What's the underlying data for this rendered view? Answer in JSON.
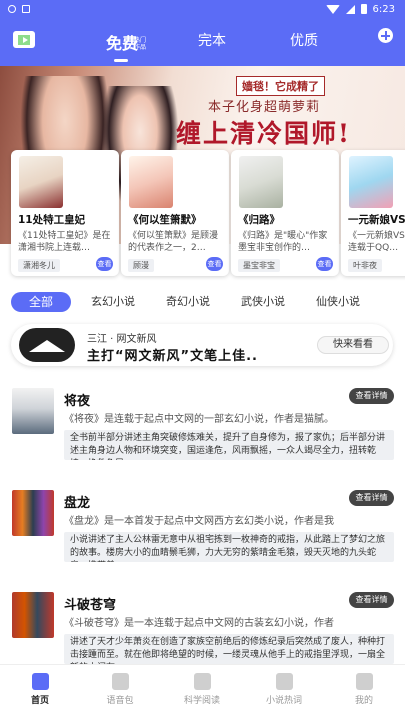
{
  "status": {
    "time": "6:23"
  },
  "nav": {
    "tabs": [
      {
        "label": "免费",
        "sub": "热门作品"
      },
      {
        "label": "完本"
      },
      {
        "label": "优质"
      }
    ]
  },
  "banner": {
    "tag": "嫱毯！它成精了",
    "subtitle": "本子化身超萌萝莉",
    "title": "缠上清冷国师!"
  },
  "featured": [
    {
      "title": "11处特工皇妃",
      "desc": "《11处特工皇妃》是在潇湘书院上连载…",
      "author": "潇湘冬儿",
      "view": "查看"
    },
    {
      "title": "《何以笙箫默》",
      "desc": "《何以笙箫默》是顾漫的代表作之一，2…",
      "author": "顾漫",
      "view": "查看"
    },
    {
      "title": "《归路》",
      "desc": "《归路》是\"暖心\"作家墨宝非宝创作的…",
      "author": "墨宝非宝",
      "view": "查看"
    },
    {
      "title": "一元新娘VS全",
      "desc": "《一元新娘VS全席》是连载于QQ…",
      "author": "叶非夜",
      "view": "查看"
    }
  ],
  "categories": [
    "全部",
    "玄幻小说",
    "奇幻小说",
    "武侠小说",
    "仙侠小说"
  ],
  "promo": {
    "top": "三江 · 网文新风",
    "main": "主打“网文新风”文笔上佳..",
    "button": "快来看看"
  },
  "books": [
    {
      "title": "将夜",
      "desc": "《将夜》是连载于起点中文网的一部玄幻小说，作者是猫腻。",
      "button": "查看详情",
      "summary": "全书前半部分讲述主角突破修炼难关，提升了自身修为，报了家仇；后半部分讲述主角身边人物和环境突变，国运逢危，风雨飘摇，一众人竭尽全力，扭转乾坤，挽救危局…"
    },
    {
      "title": "盘龙",
      "desc": "《盘龙》是一本首发于起点中文网西方玄幻类小说，作者是我吃…",
      "button": "查看详情",
      "summary": "小说讲述了主人公林雷无意中从祖宅拣到一枚神奇的戒指，从此踏上了梦幻之旅的故事。楼房大小的血睛鬃毛狮，力大无穷的紫晴金毛猿，毁天灭地的九头蛇皇，携带着…"
    },
    {
      "title": "斗破苍穹",
      "desc": "《斗破苍穹》是一本连载于起点中文网的古装玄幻小说，作者是…",
      "button": "查看详情",
      "summary": "讲述了天才少年萧炎在创造了家族空前绝后的修炼纪录后突然成了废人，种种打击接踵而至。就在他即将绝望的时候，一缕灵魂从他手上的戒指里浮现，一扇全新的大门在…"
    }
  ],
  "bottom_nav": [
    {
      "label": "首页",
      "icon": "home-icon"
    },
    {
      "label": "语音包",
      "icon": "voice-icon"
    },
    {
      "label": "科学阅读",
      "icon": "reading-icon"
    },
    {
      "label": "小说热词",
      "icon": "hotword-icon"
    },
    {
      "label": "我的",
      "icon": "profile-icon"
    }
  ],
  "colors": {
    "accent": "#5b6cf6",
    "dark_button": "#444444"
  }
}
